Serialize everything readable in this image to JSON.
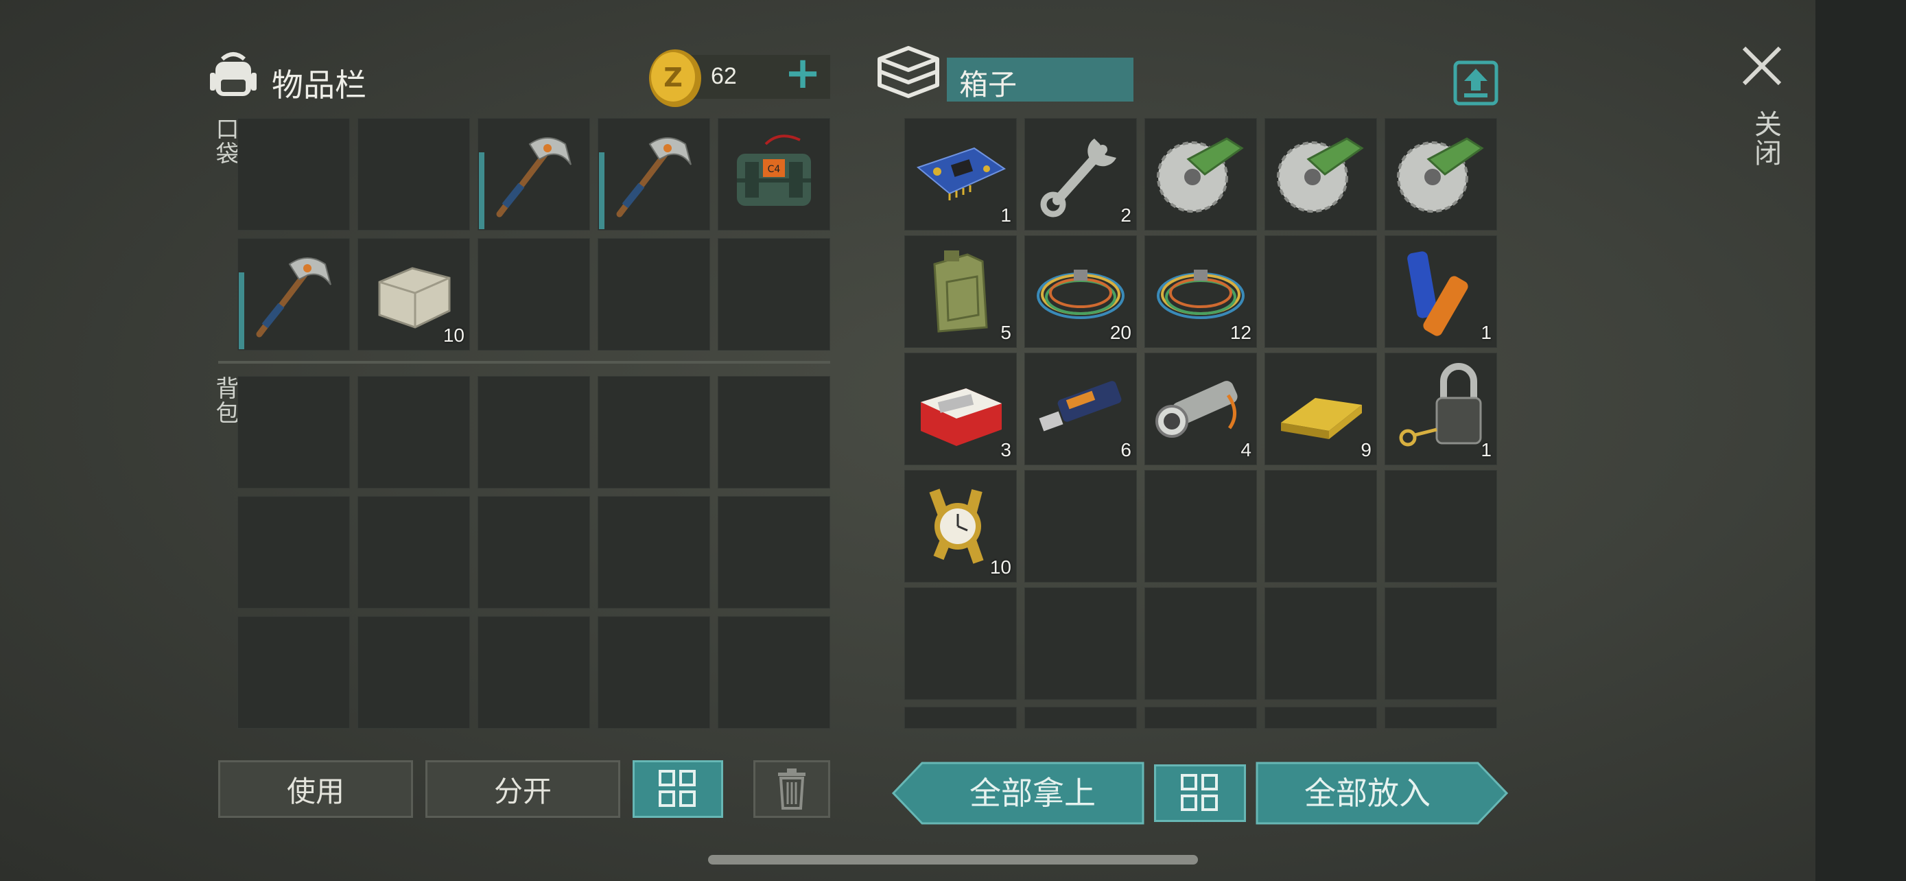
{
  "inventory": {
    "title": "物品栏",
    "coins": "62",
    "add_label": "+",
    "pocket_label": "口袋",
    "backpack_label": "背包",
    "pocket_slots": [
      {
        "item": ""
      },
      {
        "item": ""
      },
      {
        "item": "pickaxe",
        "count": "",
        "durability": true
      },
      {
        "item": "pickaxe",
        "count": "",
        "durability": true
      },
      {
        "item": "c4-explosive",
        "count": ""
      },
      {
        "item": "pickaxe",
        "count": "",
        "durability": true
      },
      {
        "item": "stone-block",
        "count": "10"
      },
      {
        "item": ""
      },
      {
        "item": ""
      },
      {
        "item": ""
      }
    ],
    "backpack_slot_count": 15
  },
  "container": {
    "title": "箱子",
    "slots": [
      {
        "item": "circuit-board",
        "count": "1"
      },
      {
        "item": "wrench",
        "count": "2"
      },
      {
        "item": "saw-blade",
        "count": ""
      },
      {
        "item": "saw-blade",
        "count": ""
      },
      {
        "item": "saw-blade",
        "count": ""
      },
      {
        "item": "jerry-can",
        "count": "5"
      },
      {
        "item": "wire-coil",
        "count": "20"
      },
      {
        "item": "wire-coil",
        "count": "12"
      },
      {
        "item": "",
        "count": ""
      },
      {
        "item": "batteries",
        "count": "1"
      },
      {
        "item": "cigarette-pack",
        "count": "3"
      },
      {
        "item": "usb-drive",
        "count": "6"
      },
      {
        "item": "flashlight",
        "count": "4"
      },
      {
        "item": "gold-bar",
        "count": "9"
      },
      {
        "item": "padlock-key",
        "count": "1"
      },
      {
        "item": "gold-watch",
        "count": "10"
      },
      {
        "item": "",
        "count": ""
      },
      {
        "item": "",
        "count": ""
      },
      {
        "item": "",
        "count": ""
      },
      {
        "item": "",
        "count": ""
      },
      {
        "item": "",
        "count": ""
      },
      {
        "item": "",
        "count": ""
      },
      {
        "item": "",
        "count": ""
      },
      {
        "item": "",
        "count": ""
      },
      {
        "item": "",
        "count": ""
      }
    ]
  },
  "buttons": {
    "use": "使用",
    "split": "分开",
    "take_all": "全部拿上",
    "put_all": "全部放入"
  },
  "close_label": "关闭",
  "colors": {
    "accent": "#3a8c8c",
    "accent_border": "#67b7b5",
    "slot": "#2c2f2c"
  }
}
